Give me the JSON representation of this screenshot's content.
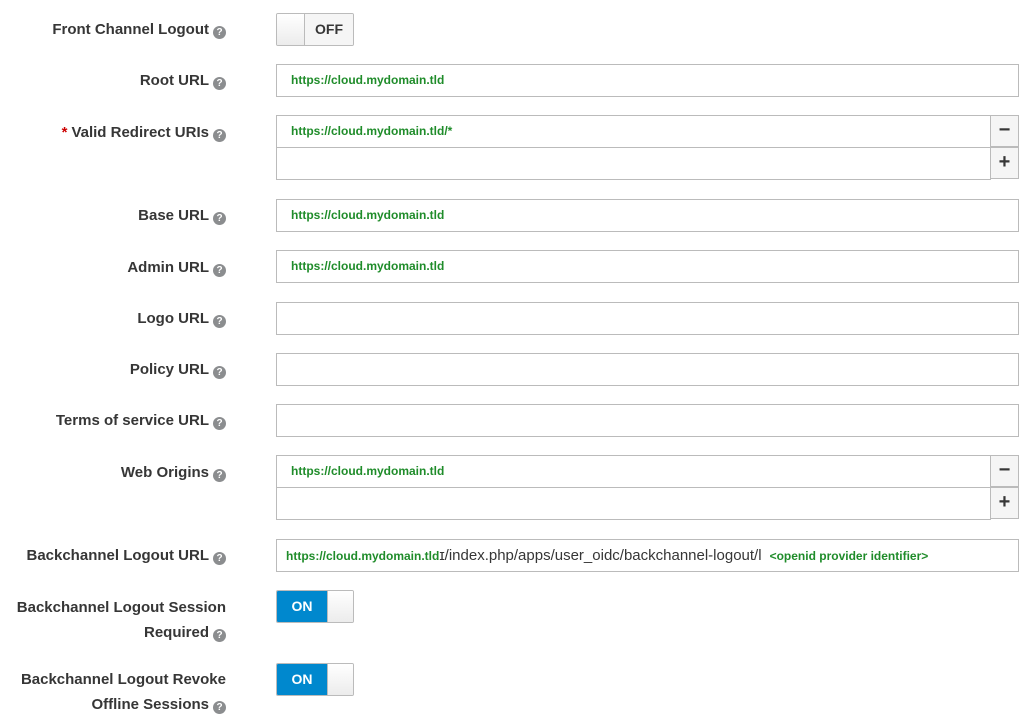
{
  "fields": {
    "front_channel_logout": {
      "label": "Front Channel Logout",
      "toggle": "OFF"
    },
    "root_url": {
      "label": "Root URL",
      "value": "https://cloud.mydomain.tld"
    },
    "valid_redirect_uris": {
      "required": "*",
      "label": "Valid Redirect URIs",
      "value": "https://cloud.mydomain.tld/*",
      "second_value": ""
    },
    "base_url": {
      "label": "Base URL",
      "value": "https://cloud.mydomain.tld"
    },
    "admin_url": {
      "label": "Admin URL",
      "value": "https://cloud.mydomain.tld"
    },
    "logo_url": {
      "label": "Logo URL",
      "value": ""
    },
    "policy_url": {
      "label": "Policy URL",
      "value": ""
    },
    "tos_url": {
      "label": "Terms of service URL",
      "value": ""
    },
    "web_origins": {
      "label": "Web Origins",
      "value": "https://cloud.mydomain.tld",
      "second_value": ""
    },
    "backchannel_logout_url": {
      "label": "Backchannel Logout URL",
      "value_host": "https://cloud.mydomain.tld",
      "value_path": "ɪ/index.php/apps/user_oidc/backchannel-logout/l",
      "annotation": "<openid provider identifier>"
    },
    "backchannel_session_required": {
      "label_line1": "Backchannel Logout Session",
      "label_line2": "Required",
      "toggle": "ON"
    },
    "backchannel_revoke_offline": {
      "label_line1": "Backchannel Logout Revoke",
      "label_line2": "Offline Sessions",
      "toggle": "ON"
    }
  },
  "icons": {
    "help": "?",
    "minus": "−",
    "plus": "+"
  },
  "colors": {
    "accent": "#0088ce",
    "annotation_green": "#1f8c2a",
    "required_red": "#cc0000"
  }
}
